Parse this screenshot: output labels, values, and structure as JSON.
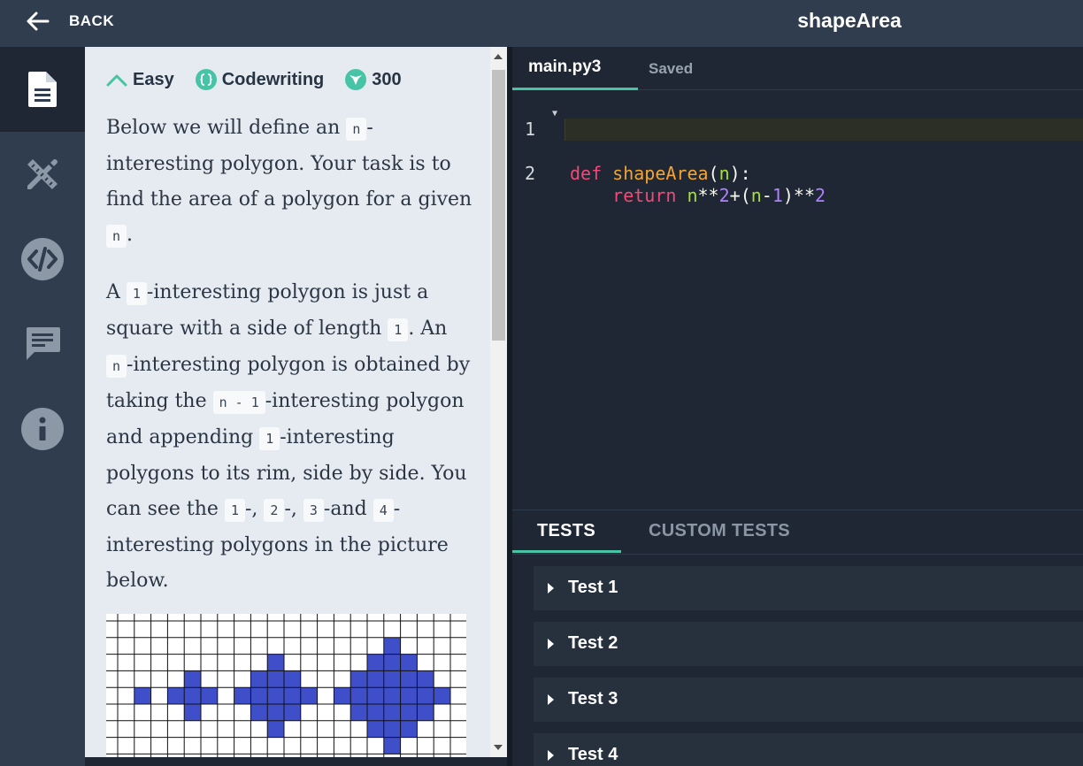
{
  "header": {
    "back_label": "BACK",
    "title": "shapeArea"
  },
  "rail": {
    "items": [
      {
        "name": "description",
        "icon": "document-icon",
        "active": true
      },
      {
        "name": "solutions",
        "icon": "pencil-ruler-icon",
        "active": false
      },
      {
        "name": "code",
        "icon": "code-icon",
        "active": false
      },
      {
        "name": "comments",
        "icon": "comment-icon",
        "active": false
      },
      {
        "name": "info",
        "icon": "info-icon",
        "active": false
      }
    ]
  },
  "task": {
    "difficulty": "Easy",
    "type": "Codewriting",
    "points": "300",
    "p1": {
      "t1": "Below we will define an ",
      "c1": "n",
      "t2": "-interesting polygon. Your task is to find the area of a polygon for a given ",
      "c2": "n",
      "t3": "."
    },
    "p2": {
      "t1": "A ",
      "c1": "1",
      "t2": "-interesting polygon is just a square with a side of length ",
      "c2": "1",
      "t3": ". An ",
      "c3": "n",
      "t4": "-interesting polygon is obtained by taking the ",
      "c4": "n - 1",
      "t5": "-interesting polygon and appending ",
      "c5": "1",
      "t6": "-interesting polygons to its rim, side by side. You can see the ",
      "c6": "1",
      "t7": "-, ",
      "c7": "2",
      "t8": "-, ",
      "c8": "3",
      "t9": "-and ",
      "c9": "4",
      "t10": "-interesting polygons in the picture below."
    }
  },
  "editor": {
    "file_tab": "main.py3",
    "status": "Saved",
    "lines": [
      {
        "num": "1",
        "kw": "def",
        "fn": "shapeArea",
        "p_open": "(",
        "param": "n",
        "p_close": "):"
      },
      {
        "num": "2",
        "indent": "    ",
        "kw": "return",
        "a": "n",
        "op1": "**",
        "n1": "2",
        "op2": "+(",
        "b": "n",
        "op3": "-",
        "n2": "1",
        "op4": ")**",
        "n3": "2"
      }
    ]
  },
  "tests": {
    "tab_active": "TESTS",
    "tab_inactive": "CUSTOM TESTS",
    "items": [
      "Test 1",
      "Test 2",
      "Test 3",
      "Test 4"
    ]
  },
  "colors": {
    "accent": "#47c4a5",
    "polygon_fill": "#3f4ec9",
    "header_bg": "#2f3d4e",
    "editor_bg": "#1e2733"
  }
}
